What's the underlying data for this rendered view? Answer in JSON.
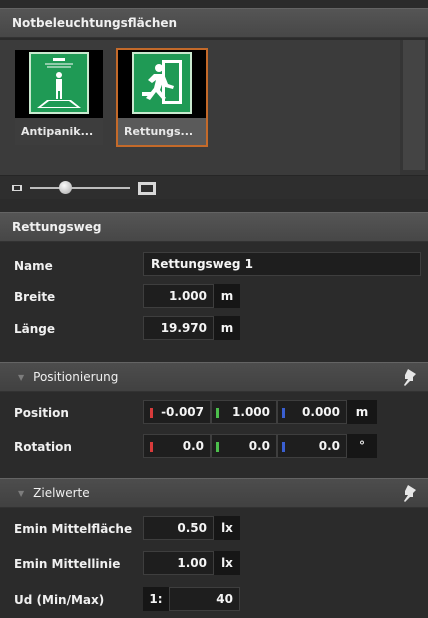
{
  "notbeleuchtung": {
    "title": "Notbeleuchtungsflächen",
    "thumbnails": [
      {
        "label": "Antipanik...",
        "icon": "antipanic-sign-icon",
        "selected": false
      },
      {
        "label": "Rettungs...",
        "icon": "emergency-exit-sign-icon",
        "selected": true
      }
    ],
    "zoom_level": 0.35
  },
  "rettungsweg": {
    "title": "Rettungsweg",
    "name_label": "Name",
    "name_value": "Rettungsweg 1",
    "breite_label": "Breite",
    "breite_value": "1.000",
    "breite_unit": "m",
    "laenge_label": "Länge",
    "laenge_value": "19.970",
    "laenge_unit": "m"
  },
  "positionierung": {
    "title": "Positionierung",
    "position_label": "Position",
    "position": {
      "x": "-0.007",
      "y": "1.000",
      "z": "0.000",
      "unit": "m"
    },
    "rotation_label": "Rotation",
    "rotation": {
      "x": "0.0",
      "y": "0.0",
      "z": "0.0",
      "unit": "°"
    }
  },
  "zielwerte": {
    "title": "Zielwerte",
    "emin_flaeche_label": "Emin Mittelfläche",
    "emin_flaeche_value": "0.50",
    "emin_flaeche_unit": "lx",
    "emin_linie_label": "Emin Mittellinie",
    "emin_linie_value": "1.00",
    "emin_linie_unit": "lx",
    "ud_label": "Ud (Min/Max)",
    "ud_prefix": "1:",
    "ud_value": "40"
  },
  "colors": {
    "background": "#2b2b2b",
    "header": "#4a4a4a",
    "field": "#1e1e1e",
    "selection": "#c46a2a",
    "sign_green": "#1f9a55",
    "axis_x": "#d83b3b",
    "axis_y": "#4cbf4c",
    "axis_z": "#3a5fd1"
  }
}
